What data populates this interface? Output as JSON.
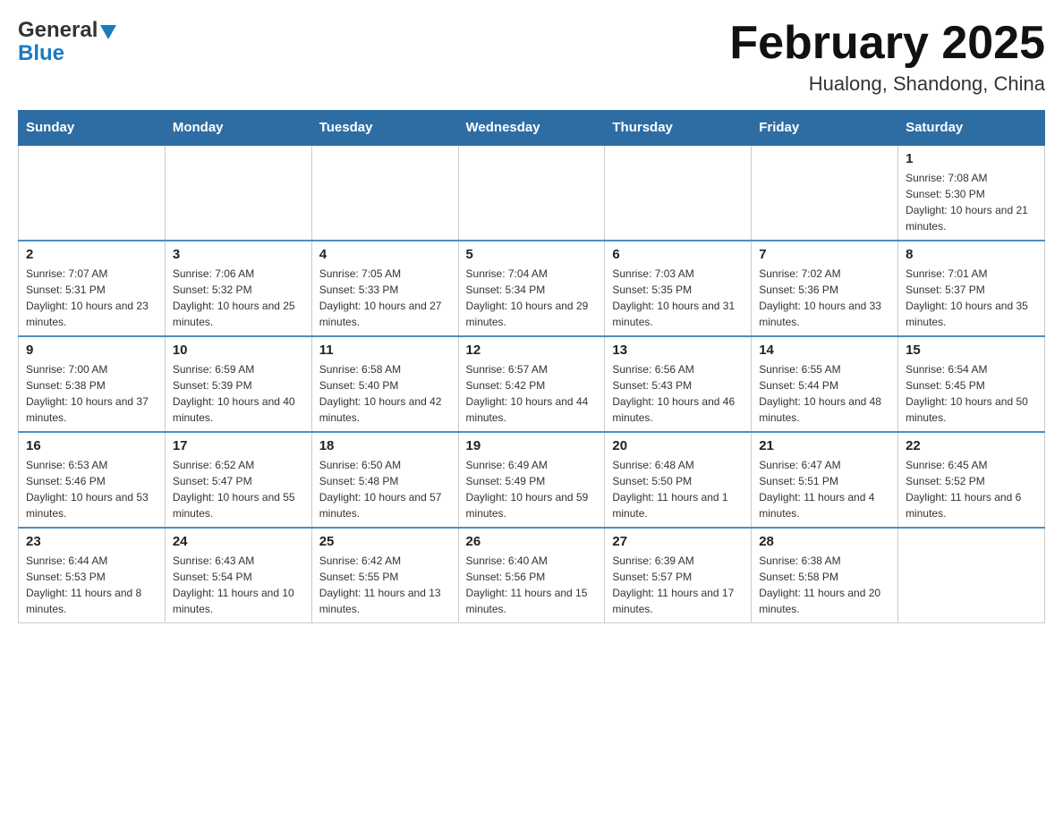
{
  "header": {
    "logo": {
      "general": "General",
      "blue": "Blue"
    },
    "title": "February 2025",
    "location": "Hualong, Shandong, China"
  },
  "weekdays": [
    "Sunday",
    "Monday",
    "Tuesday",
    "Wednesday",
    "Thursday",
    "Friday",
    "Saturday"
  ],
  "weeks": [
    [
      {
        "day": "",
        "info": ""
      },
      {
        "day": "",
        "info": ""
      },
      {
        "day": "",
        "info": ""
      },
      {
        "day": "",
        "info": ""
      },
      {
        "day": "",
        "info": ""
      },
      {
        "day": "",
        "info": ""
      },
      {
        "day": "1",
        "info": "Sunrise: 7:08 AM\nSunset: 5:30 PM\nDaylight: 10 hours and 21 minutes."
      }
    ],
    [
      {
        "day": "2",
        "info": "Sunrise: 7:07 AM\nSunset: 5:31 PM\nDaylight: 10 hours and 23 minutes."
      },
      {
        "day": "3",
        "info": "Sunrise: 7:06 AM\nSunset: 5:32 PM\nDaylight: 10 hours and 25 minutes."
      },
      {
        "day": "4",
        "info": "Sunrise: 7:05 AM\nSunset: 5:33 PM\nDaylight: 10 hours and 27 minutes."
      },
      {
        "day": "5",
        "info": "Sunrise: 7:04 AM\nSunset: 5:34 PM\nDaylight: 10 hours and 29 minutes."
      },
      {
        "day": "6",
        "info": "Sunrise: 7:03 AM\nSunset: 5:35 PM\nDaylight: 10 hours and 31 minutes."
      },
      {
        "day": "7",
        "info": "Sunrise: 7:02 AM\nSunset: 5:36 PM\nDaylight: 10 hours and 33 minutes."
      },
      {
        "day": "8",
        "info": "Sunrise: 7:01 AM\nSunset: 5:37 PM\nDaylight: 10 hours and 35 minutes."
      }
    ],
    [
      {
        "day": "9",
        "info": "Sunrise: 7:00 AM\nSunset: 5:38 PM\nDaylight: 10 hours and 37 minutes."
      },
      {
        "day": "10",
        "info": "Sunrise: 6:59 AM\nSunset: 5:39 PM\nDaylight: 10 hours and 40 minutes."
      },
      {
        "day": "11",
        "info": "Sunrise: 6:58 AM\nSunset: 5:40 PM\nDaylight: 10 hours and 42 minutes."
      },
      {
        "day": "12",
        "info": "Sunrise: 6:57 AM\nSunset: 5:42 PM\nDaylight: 10 hours and 44 minutes."
      },
      {
        "day": "13",
        "info": "Sunrise: 6:56 AM\nSunset: 5:43 PM\nDaylight: 10 hours and 46 minutes."
      },
      {
        "day": "14",
        "info": "Sunrise: 6:55 AM\nSunset: 5:44 PM\nDaylight: 10 hours and 48 minutes."
      },
      {
        "day": "15",
        "info": "Sunrise: 6:54 AM\nSunset: 5:45 PM\nDaylight: 10 hours and 50 minutes."
      }
    ],
    [
      {
        "day": "16",
        "info": "Sunrise: 6:53 AM\nSunset: 5:46 PM\nDaylight: 10 hours and 53 minutes."
      },
      {
        "day": "17",
        "info": "Sunrise: 6:52 AM\nSunset: 5:47 PM\nDaylight: 10 hours and 55 minutes."
      },
      {
        "day": "18",
        "info": "Sunrise: 6:50 AM\nSunset: 5:48 PM\nDaylight: 10 hours and 57 minutes."
      },
      {
        "day": "19",
        "info": "Sunrise: 6:49 AM\nSunset: 5:49 PM\nDaylight: 10 hours and 59 minutes."
      },
      {
        "day": "20",
        "info": "Sunrise: 6:48 AM\nSunset: 5:50 PM\nDaylight: 11 hours and 1 minute."
      },
      {
        "day": "21",
        "info": "Sunrise: 6:47 AM\nSunset: 5:51 PM\nDaylight: 11 hours and 4 minutes."
      },
      {
        "day": "22",
        "info": "Sunrise: 6:45 AM\nSunset: 5:52 PM\nDaylight: 11 hours and 6 minutes."
      }
    ],
    [
      {
        "day": "23",
        "info": "Sunrise: 6:44 AM\nSunset: 5:53 PM\nDaylight: 11 hours and 8 minutes."
      },
      {
        "day": "24",
        "info": "Sunrise: 6:43 AM\nSunset: 5:54 PM\nDaylight: 11 hours and 10 minutes."
      },
      {
        "day": "25",
        "info": "Sunrise: 6:42 AM\nSunset: 5:55 PM\nDaylight: 11 hours and 13 minutes."
      },
      {
        "day": "26",
        "info": "Sunrise: 6:40 AM\nSunset: 5:56 PM\nDaylight: 11 hours and 15 minutes."
      },
      {
        "day": "27",
        "info": "Sunrise: 6:39 AM\nSunset: 5:57 PM\nDaylight: 11 hours and 17 minutes."
      },
      {
        "day": "28",
        "info": "Sunrise: 6:38 AM\nSunset: 5:58 PM\nDaylight: 11 hours and 20 minutes."
      },
      {
        "day": "",
        "info": ""
      }
    ]
  ]
}
